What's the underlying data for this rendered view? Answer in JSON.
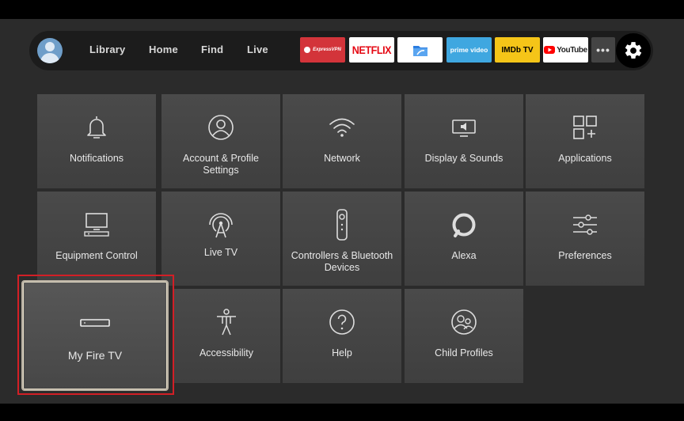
{
  "nav": {
    "links": [
      "Library",
      "Home",
      "Find",
      "Live"
    ],
    "apps": [
      {
        "label": "ExpressVPN",
        "bg": "#d3343a",
        "fg": "#ffffff"
      },
      {
        "label": "NETFLIX",
        "bg": "#ffffff",
        "fg": "#e50914"
      },
      {
        "label": "",
        "bg": "#ffffff",
        "fg": "#2b7de0"
      },
      {
        "label": "prime video",
        "bg": "#3fa7e0",
        "fg": "#ffffff"
      },
      {
        "label": "IMDb TV",
        "bg": "#f5c518",
        "fg": "#000000"
      },
      {
        "label": "YouTube",
        "bg": "#ffffff",
        "fg": "#222222"
      }
    ],
    "more_label": "•••"
  },
  "tiles": [
    {
      "label": "Notifications",
      "icon": "bell-icon"
    },
    {
      "label": "Account & Profile Settings",
      "icon": "profile-icon"
    },
    {
      "label": "Network",
      "icon": "wifi-icon"
    },
    {
      "label": "Display & Sounds",
      "icon": "display-icon"
    },
    {
      "label": "Applications",
      "icon": "apps-icon"
    },
    {
      "label": "Equipment Control",
      "icon": "equipment-icon"
    },
    {
      "label": "Live TV",
      "icon": "antenna-icon"
    },
    {
      "label": "Controllers & Bluetooth Devices",
      "icon": "remote-icon"
    },
    {
      "label": "Alexa",
      "icon": "alexa-icon"
    },
    {
      "label": "Preferences",
      "icon": "sliders-icon"
    },
    {
      "label": "My Fire TV",
      "icon": "fire-tv-device-icon"
    },
    {
      "label": "Accessibility",
      "icon": "accessibility-icon"
    },
    {
      "label": "Help",
      "icon": "help-icon"
    },
    {
      "label": "Child Profiles",
      "icon": "child-profile-icon"
    }
  ],
  "colors": {
    "background": "#2b2b2b",
    "tile": "#444444",
    "highlight": "#d21f26"
  }
}
